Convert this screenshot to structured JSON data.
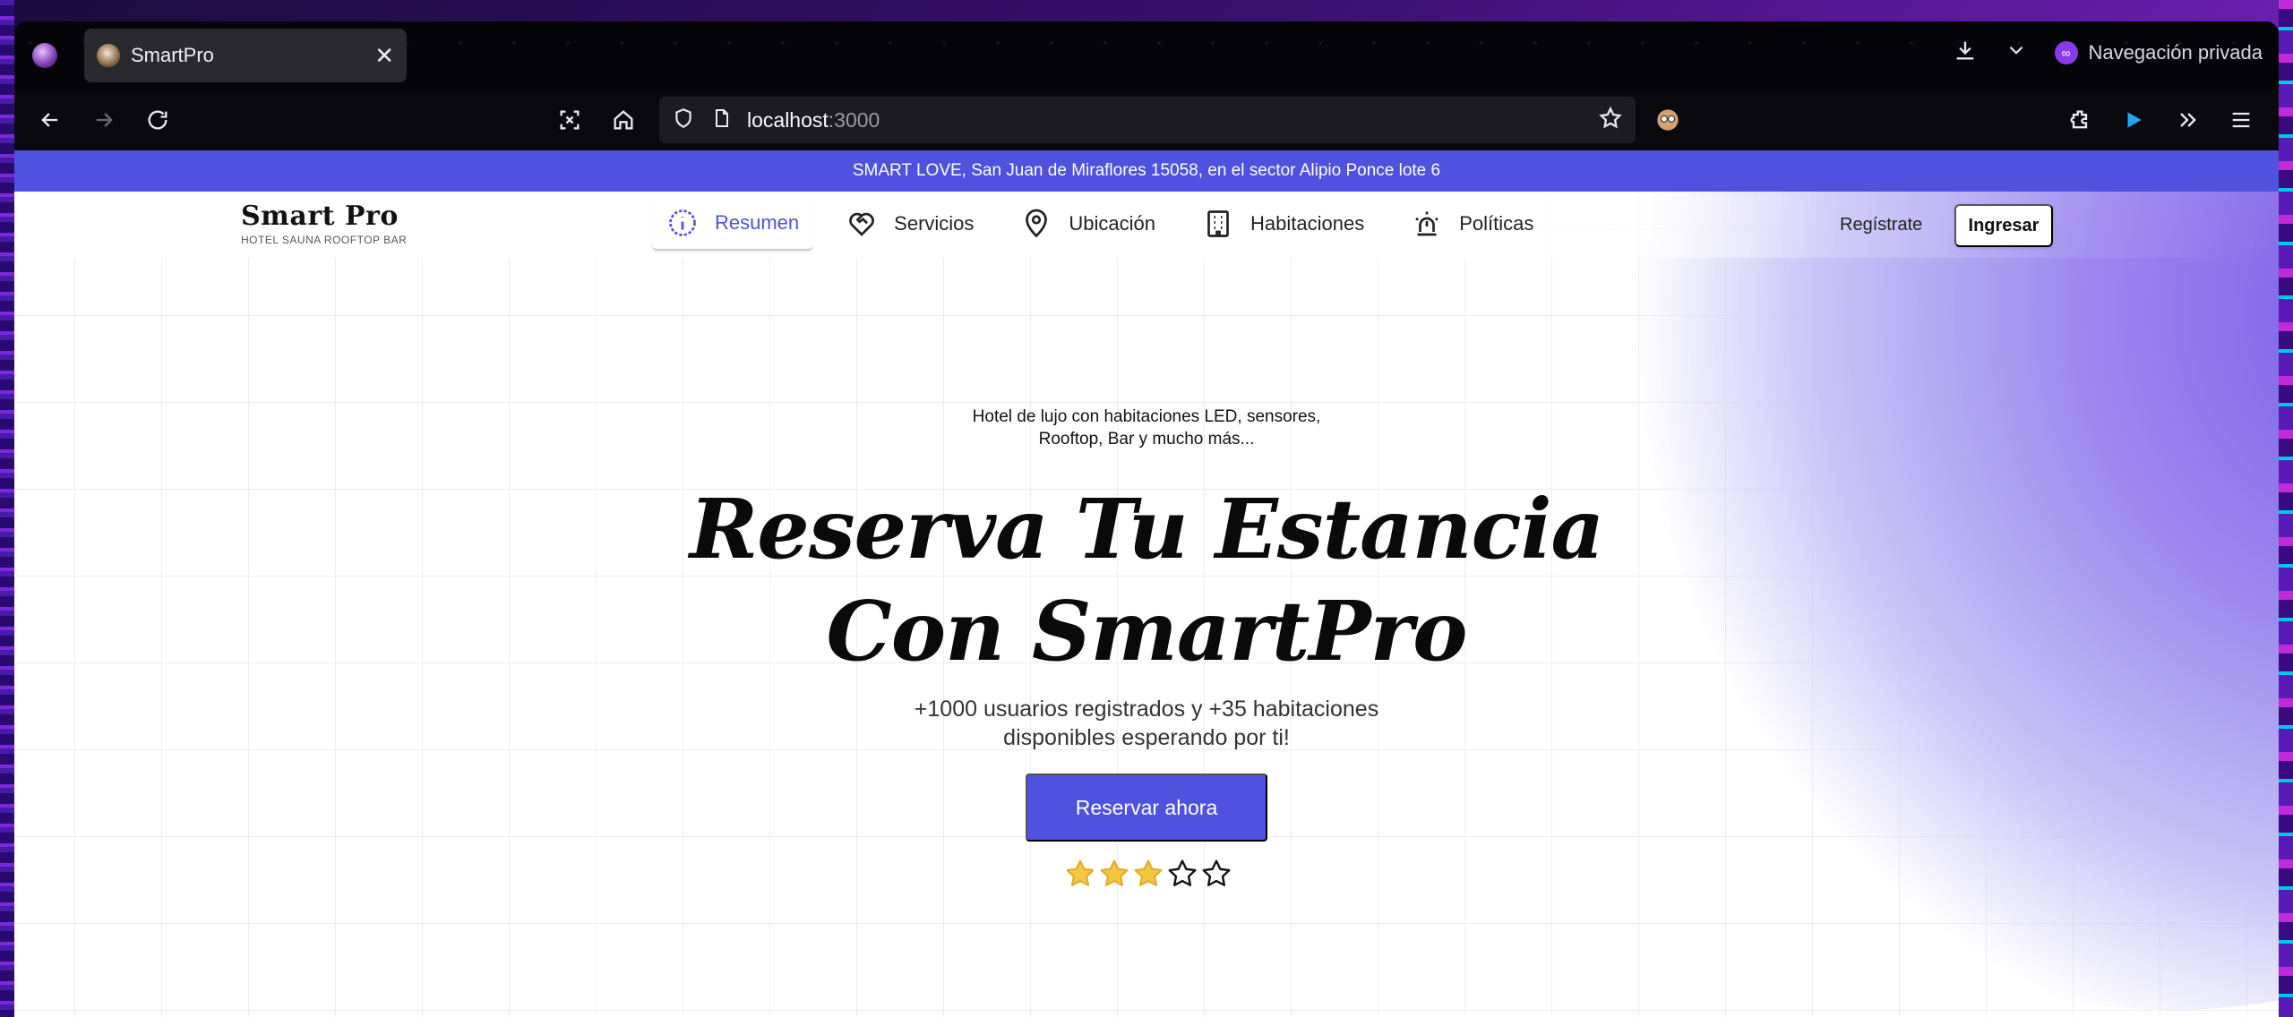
{
  "browser": {
    "tab_title": "SmartPro",
    "url_host": "localhost",
    "url_port": ":3000",
    "private_label": "Navegación privada"
  },
  "site": {
    "announcement": "SMART LOVE, San Juan de Miraflores 15058, en el sector Alipio Ponce lote 6",
    "logo_title": "Smart Pro",
    "logo_subtitle": "HOTEL SAUNA ROOFTOP BAR",
    "nav": [
      {
        "label": "Resumen",
        "icon": "info-icon",
        "active": true
      },
      {
        "label": "Servicios",
        "icon": "heart-handshake-icon",
        "active": false
      },
      {
        "label": "Ubicación",
        "icon": "map-pin-icon",
        "active": false
      },
      {
        "label": "Habitaciones",
        "icon": "building-icon",
        "active": false
      },
      {
        "label": "Políticas",
        "icon": "alarm-light-icon",
        "active": false
      }
    ],
    "register_label": "Regístrate",
    "login_label": "Ingresar"
  },
  "hero": {
    "tagline_line1": "Hotel de lujo con habitaciones LED, sensores,",
    "tagline_line2": "Rooftop, Bar y mucho más...",
    "title_line1": "Reserva Tu Estancia",
    "title_line2": "Con SmartPro",
    "subtitle_line1": "+1000 usuarios registrados y +35 habitaciones",
    "subtitle_line2": "disponibles esperando por ti!",
    "cta_label": "Reservar ahora",
    "rating": 3,
    "rating_max": 5
  },
  "colors": {
    "accent": "#4f52de",
    "star_filled": "#f5c842"
  }
}
